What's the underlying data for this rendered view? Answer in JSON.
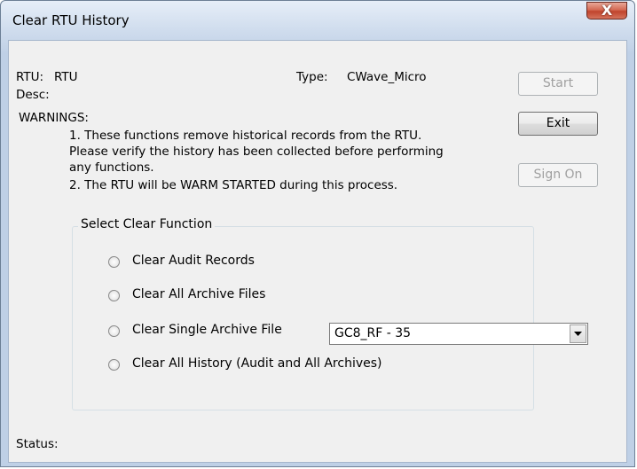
{
  "window": {
    "title": "Clear RTU History",
    "close_glyph": "X"
  },
  "info": {
    "rtu_label": "RTU:",
    "rtu_value": "RTU",
    "type_label": "Type:",
    "type_value": "CWave_Micro",
    "desc_label": "Desc:"
  },
  "warnings": {
    "heading": "WARNINGS:",
    "line1": "1. These functions remove historical records from the RTU.",
    "line2": "Please verify the history has been collected before performing",
    "line3": "any functions.",
    "line4": "2. The RTU will be WARM STARTED during this process."
  },
  "buttons": {
    "start": "Start",
    "exit": "Exit",
    "sign_on": "Sign On"
  },
  "group": {
    "title": "Select Clear Function",
    "options": [
      {
        "label": "Clear Audit Records",
        "selected": false
      },
      {
        "label": "Clear All Archive Files",
        "selected": false
      },
      {
        "label": "Clear Single Archive File",
        "selected": false
      },
      {
        "label": "Clear All History (Audit and All Archives)",
        "selected": false
      }
    ],
    "archive_select": {
      "value": "GC8_RF - 35",
      "icon": "chevron-down-icon"
    }
  },
  "status": {
    "label": "Status:"
  }
}
